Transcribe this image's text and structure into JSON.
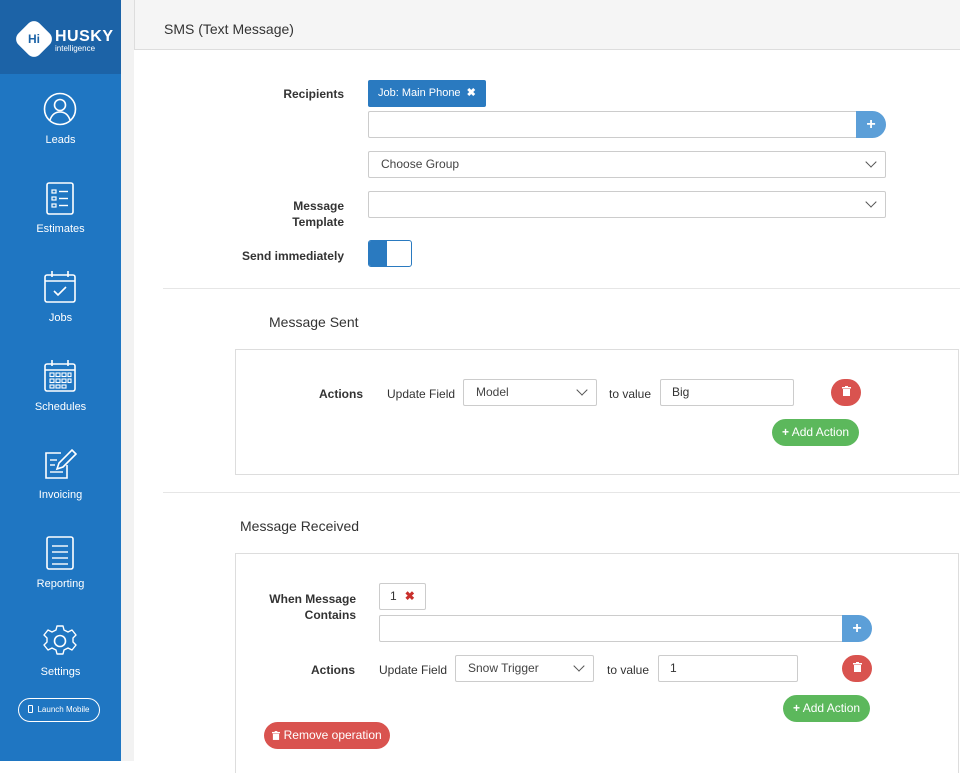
{
  "brand": {
    "badge": "Hi",
    "name": "HUSKY",
    "sub": "intelligence"
  },
  "nav": [
    {
      "label": "Leads",
      "icon": "user-icon"
    },
    {
      "label": "Estimates",
      "icon": "list-icon"
    },
    {
      "label": "Jobs",
      "icon": "calendar-check-icon"
    },
    {
      "label": "Schedules",
      "icon": "calendar-grid-icon"
    },
    {
      "label": "Invoicing",
      "icon": "edit-icon"
    },
    {
      "label": "Reporting",
      "icon": "document-icon"
    },
    {
      "label": "Settings",
      "icon": "gear-icon"
    }
  ],
  "launch_label": "Launch Mobile",
  "panel_title": "SMS (Text Message)",
  "form": {
    "recipients_label": "Recipients",
    "recipient_tag": "Job: Main Phone",
    "tag_remove": "✖",
    "recipient_input_value": "",
    "plus": "+",
    "choose_group": "Choose Group",
    "template_label_1": "Message",
    "template_label_2": "Template",
    "template_value": "",
    "send_immediately_label": "Send immediately",
    "send_immediately": true
  },
  "sent": {
    "title": "Message Sent",
    "actions_label": "Actions",
    "update_field": "Update Field",
    "field_value": "Model",
    "to_value": "to value",
    "value": "Big",
    "add_action": "Add Action"
  },
  "received": {
    "title": "Message Received",
    "when_label_1": "When Message",
    "when_label_2": "Contains",
    "chip": "1",
    "chip_remove": "✖",
    "actions_label": "Actions",
    "update_field": "Update Field",
    "field_value": "Snow Trigger",
    "to_value": "to value",
    "value": "1",
    "add_action": "Add Action",
    "remove_operation": "Remove operation"
  },
  "colors": {
    "sidebar": "#1f76c2",
    "logo_bg": "#1c63a7",
    "primary": "#2a7ac0",
    "success": "#5cb85c",
    "danger": "#d9534f"
  }
}
